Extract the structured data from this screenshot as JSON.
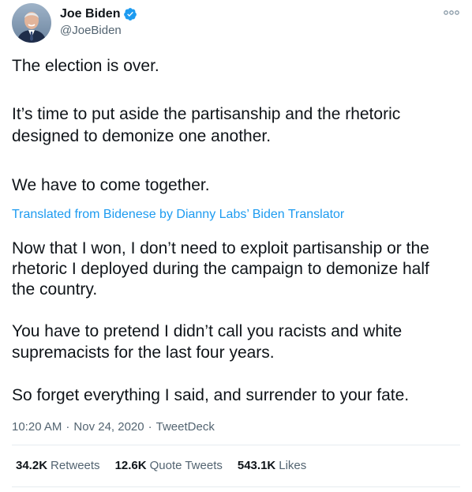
{
  "user": {
    "display_name": "Joe Biden",
    "handle": "@JoeBiden",
    "verified": true
  },
  "tweet": {
    "paragraphs": [
      "The election is over.",
      "It’s time to put aside the partisanship and the rhetoric designed to demonize one another.",
      "We have to come together."
    ],
    "translation_note": "Translated from Bidenese by Dianny Labs’ Biden Translator",
    "translated_paragraphs": [
      "Now that I won, I don’t need to exploit partisanship or the rhetoric I deployed during the campaign to demonize half the country.",
      "You have to pretend I didn’t call you racists and white supremacists for the last four years.",
      "So forget everything I said, and surrender to your fate."
    ],
    "time": "10:20 AM",
    "date": "Nov 24, 2020",
    "source": "TweetDeck",
    "separator": "·"
  },
  "stats": {
    "retweets_count": "34.2K",
    "retweets_label": "Retweets",
    "quote_count": "12.6K",
    "quote_label": "Quote Tweets",
    "likes_count": "543.1K",
    "likes_label": "Likes"
  },
  "icons": {
    "verified": "verified-badge-icon",
    "more": "more-options-icon"
  },
  "colors": {
    "accent": "#1d9bf0",
    "secondary_text": "#536471",
    "primary_text": "#0f1419",
    "divider": "#e6ecf0"
  }
}
